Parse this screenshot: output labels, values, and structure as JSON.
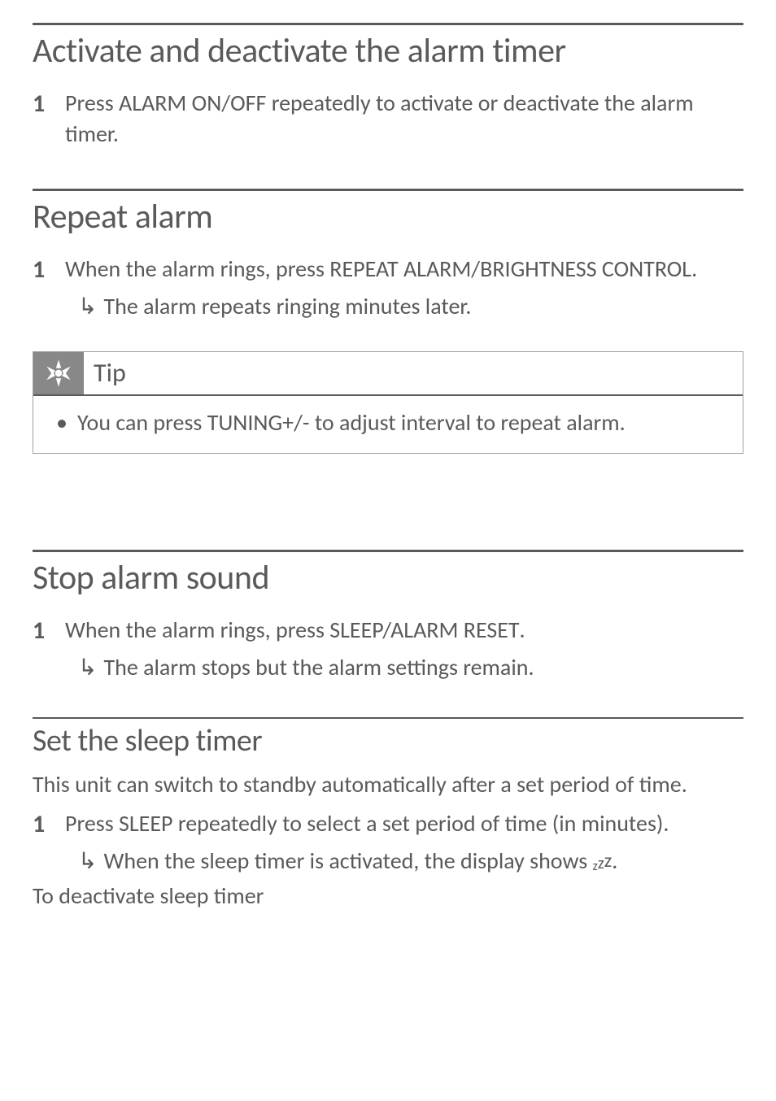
{
  "sections": {
    "activate": {
      "title": "Activate and deactivate the alarm timer",
      "step_num": "1",
      "step_pre": "Press ",
      "step_bold": "ALARM ON/OFF",
      "step_post": " repeatedly to activate or deactivate the alarm timer."
    },
    "repeat": {
      "title": "Repeat alarm",
      "step_num": "1",
      "step_pre": "When the alarm rings, press ",
      "step_bold": "REPEAT ALARM/BRIGHTNESS CONTROL",
      "step_post": ".",
      "result": "The alarm repeats ringing minutes later.",
      "tip_label": "Tip",
      "tip_pre": "You can press ",
      "tip_bold": "TUNING+/-",
      "tip_post": " to adjust interval to repeat alarm."
    },
    "stop": {
      "title": "Stop alarm sound",
      "step_num": "1",
      "step_pre": "When the alarm rings, press ",
      "step_bold": "SLEEP/ALARM RESET",
      "step_post": ".",
      "result": "The alarm stops but the alarm settings remain."
    },
    "sleep": {
      "title": "Set the sleep timer",
      "intro": "This unit can switch to standby automatically after a set period of time.",
      "step_num": "1",
      "step_pre": "Press ",
      "step_bold": "SLEEP",
      "step_post": " repeatedly to select a set period of time (in minutes).",
      "result_pre": "When the sleep timer is activated, the display shows ",
      "result_post": ".",
      "deactivate": "To deactivate sleep timer"
    }
  }
}
